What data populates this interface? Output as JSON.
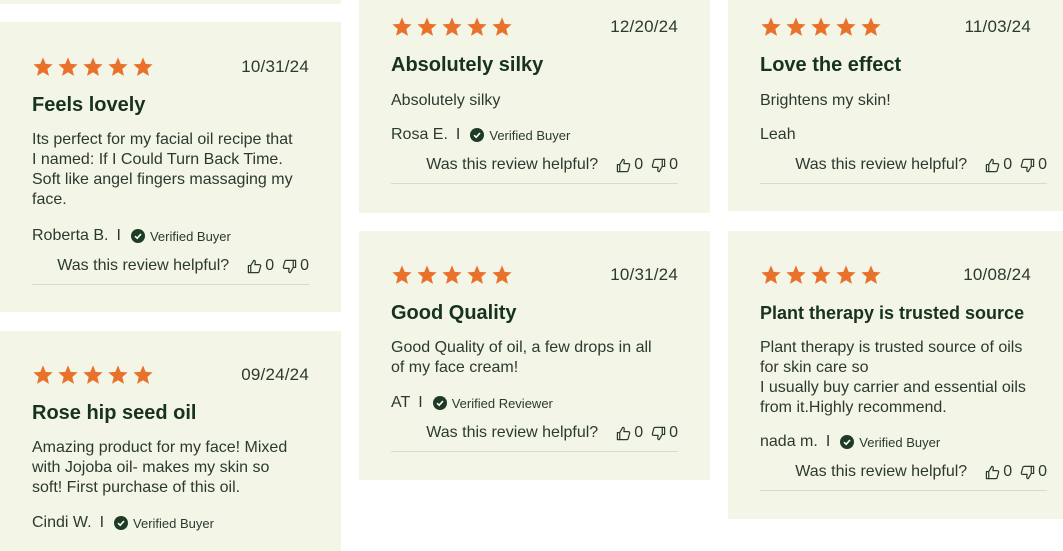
{
  "colors": {
    "card_bg": "#f3f5e6",
    "star": "#e8712b",
    "text": "#2b3a2f",
    "title": "#17321f",
    "check": "#1d3b26"
  },
  "helpful_label": "Was this review helpful?",
  "reviews": [
    {
      "date": "10/31/24",
      "title": "Feels lovely",
      "body": [
        "Its perfect for my facial oil recipe that",
        "I named: If I Could Turn Back Time.",
        "Soft like angel fingers massaging my",
        "face."
      ],
      "author": "Roberta B.",
      "separator": "I",
      "badge": "Verified Buyer",
      "up": "0",
      "down": "0",
      "rating": 5
    },
    {
      "date": "09/24/24",
      "title": "Rose hip seed oil",
      "body": [
        "Amazing product for my face! Mixed",
        "with Jojoba oil- makes my skin so",
        "soft! First purchase of this oil."
      ],
      "author": "Cindi W.",
      "separator": "I",
      "badge": "Verified Buyer",
      "rating": 5
    },
    {
      "date": "12/20/24",
      "title": "Absolutely silky",
      "body": [
        "Absolutely silky"
      ],
      "author": "Rosa E.",
      "separator": "I",
      "badge": "Verified Buyer",
      "up": "0",
      "down": "0",
      "rating": 5
    },
    {
      "date": "10/31/24",
      "title": "Good Quality",
      "body": [
        "Good Quality of oil, a few drops in all",
        "of my face cream!"
      ],
      "author": "AT",
      "separator": "I",
      "badge": "Verified Reviewer",
      "up": "0",
      "down": "0",
      "rating": 5
    },
    {
      "date": "11/03/24",
      "title": "Love the effect",
      "body": [
        "Brightens my skin!"
      ],
      "author": "Leah",
      "up": "0",
      "down": "0",
      "rating": 5
    },
    {
      "date": "10/08/24",
      "title": "Plant therapy is trusted source",
      "body": [
        "Plant therapy is trusted source of oils",
        "for skin care so",
        "I usually buy carrier and essential oils",
        "from it.Highly recommend."
      ],
      "author": "nada m.",
      "separator": "I",
      "badge": "Verified Buyer",
      "up": "0",
      "down": "0",
      "rating": 5
    }
  ]
}
